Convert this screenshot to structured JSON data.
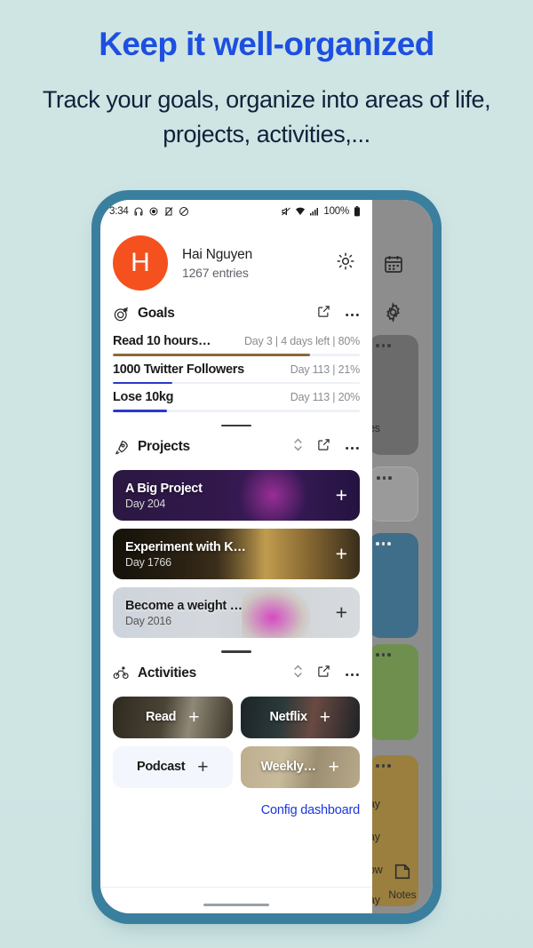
{
  "promo": {
    "title": "Keep it well-organized",
    "subtitle": "Track your goals, organize into areas of life, projects, activities,...",
    "title_color": "#1d4fe0"
  },
  "statusbar": {
    "time": "3:34",
    "battery_percent": "100%",
    "icons_left": [
      "headphone-icon",
      "sync-disabled-icon",
      "no-sim-icon",
      "do-not-disturb-icon"
    ],
    "icons_right": [
      "mute-icon",
      "wifi-icon",
      "signal-icon",
      "battery-icon"
    ]
  },
  "profile": {
    "avatar_initial": "H",
    "avatar_color": "#f4511e",
    "name": "Hai Nguyen",
    "entries": "1267 entries",
    "brightness_icon": "sun-icon"
  },
  "goals_section": {
    "icon": "target-icon",
    "title": "Goals",
    "tools": [
      "open-external-icon",
      "more-options-icon"
    ],
    "items": [
      {
        "name": "Read 10 hours…",
        "meta": "Day 3 | 4 days left | 80%",
        "progress": 80,
        "color": "#8a6a3a"
      },
      {
        "name": "1000 Twitter Followers",
        "meta": "Day 113 | 21%",
        "progress": 21,
        "color": "#2b39c9"
      },
      {
        "name": "Lose 10kg",
        "meta": "Day 113 | 20%",
        "progress": 20,
        "color": "#2b39c9"
      }
    ]
  },
  "projects_section": {
    "icon": "rocket-icon",
    "title": "Projects",
    "tools": [
      "sort-icon",
      "open-external-icon",
      "more-options-icon"
    ],
    "items": [
      {
        "title": "A Big Project",
        "day": "Day 204",
        "theme": "dark",
        "bg": "#2a1740",
        "add_label": "+"
      },
      {
        "title": "Experiment with K…",
        "day": "Day 1766",
        "theme": "dark",
        "bg": "#3a3122",
        "add_label": "+"
      },
      {
        "title": "Become a weight …",
        "day": "Day 2016",
        "theme": "light",
        "bg": "#ced4dc",
        "add_label": "+"
      }
    ]
  },
  "activities_section": {
    "icon": "bike-icon",
    "title": "Activities",
    "tools": [
      "sort-icon",
      "open-external-icon",
      "more-options-icon"
    ],
    "items": [
      {
        "label": "Read",
        "theme": "dark",
        "bg": "#3a3528",
        "add_label": "+"
      },
      {
        "label": "Netflix",
        "theme": "dark",
        "bg": "#20282c",
        "add_label": "+"
      },
      {
        "label": "Podcast",
        "theme": "light",
        "bg": "#f3f6fc",
        "add_label": "+"
      },
      {
        "label": "Weekly…",
        "theme": "dark",
        "bg": "#b3a383",
        "add_label": "+"
      }
    ]
  },
  "footer": {
    "config_label": "Config dashboard",
    "config_color": "#1a36e0"
  },
  "behind_panel": {
    "icons": [
      "calendar-icon",
      "settings-icon"
    ],
    "cards": [
      {
        "color": "#6b6b6b",
        "text": "es"
      },
      {
        "color": "#9a9a9a",
        "text": ""
      },
      {
        "color": "#3f6e8a",
        "text": ""
      },
      {
        "color": "#6e8f4e",
        "text": ""
      },
      {
        "color": "#9a7f3f",
        "text": "ay"
      }
    ],
    "notes_label": "Notes",
    "notes_icon": "note-icon"
  },
  "frame": {
    "bezel_color": "#3b7f9e",
    "background_color": "#cfe5e4"
  }
}
